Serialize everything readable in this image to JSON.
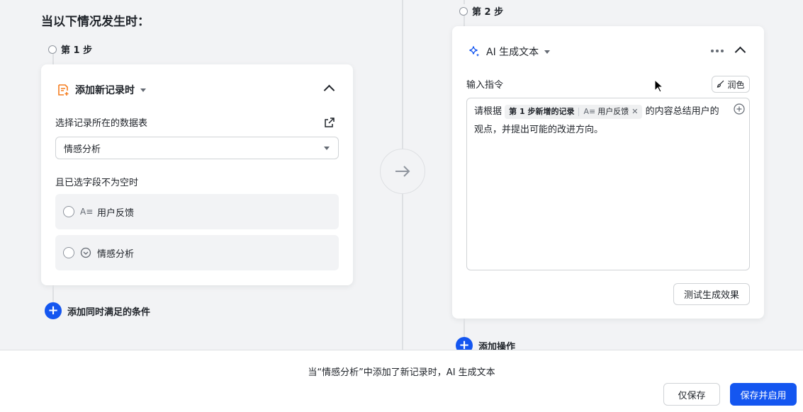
{
  "left": {
    "heading": "当以下情况发生时：",
    "step": "第 1 步",
    "trigger": {
      "title": "添加新记录时",
      "table_label": "选择记录所在的数据表",
      "table_value": "情感分析",
      "fields_label": "且已选字段不为空时",
      "fields": [
        {
          "icon": "A≡",
          "label": "用户反馈"
        },
        {
          "icon": "⌄",
          "label": "情感分析"
        }
      ]
    },
    "add_condition": "添加同时满足的条件"
  },
  "right": {
    "step": "第 2 步",
    "action": {
      "title": "AI 生成文本",
      "prompt_label": "输入指令",
      "polish_label": "润色",
      "prompt_prefix": "请根据",
      "chip_source": "第 1 步新增的记录",
      "chip_field_icon": "A≡",
      "chip_field": "用户反馈",
      "prompt_line1_suffix": "的内容总结用户的",
      "prompt_line2": "观点，并提出可能的改进方向。",
      "test_button": "测试生成效果"
    },
    "add_action": "添加操作"
  },
  "footer": {
    "summary": "当“情感分析”中添加了新记录时，AI 生成文本",
    "save_only": "仅保存",
    "save_enable": "保存并启用"
  },
  "colors": {
    "primary": "#1456f0",
    "trigger_icon": "#f57d1f",
    "ai_icon": "#1456f0"
  }
}
